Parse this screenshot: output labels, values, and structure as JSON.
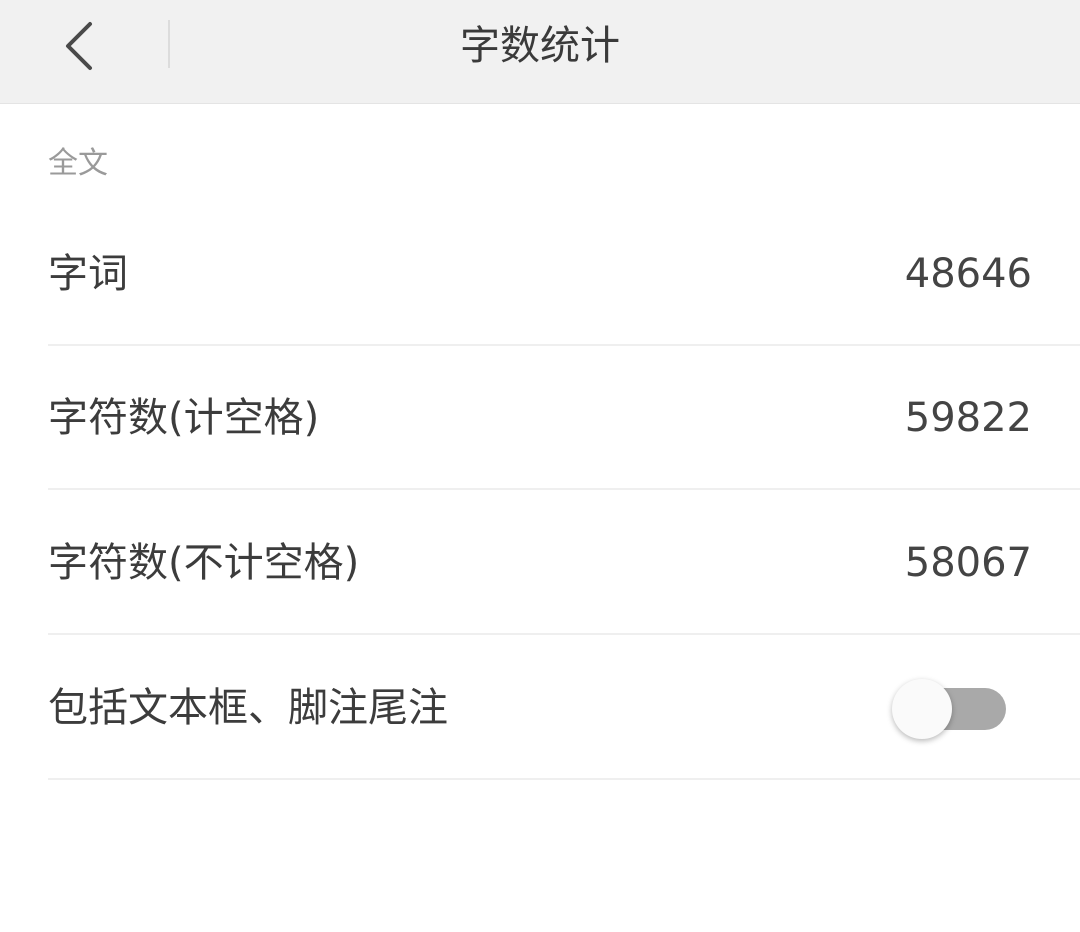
{
  "header": {
    "title": "字数统计",
    "back_icon": "chevron-left-icon"
  },
  "section": {
    "label": "全文"
  },
  "rows": [
    {
      "label": "字词",
      "value": "48646"
    },
    {
      "label": "字符数(计空格)",
      "value": "59822"
    },
    {
      "label": "字符数(不计空格)",
      "value": "58067"
    },
    {
      "label": "包括文本框、脚注尾注",
      "toggle_on": false
    }
  ],
  "colors": {
    "header_bg": "#f1f1f1",
    "toggle_track_off": "#a9a9a9",
    "toggle_knob": "#fafafa"
  }
}
